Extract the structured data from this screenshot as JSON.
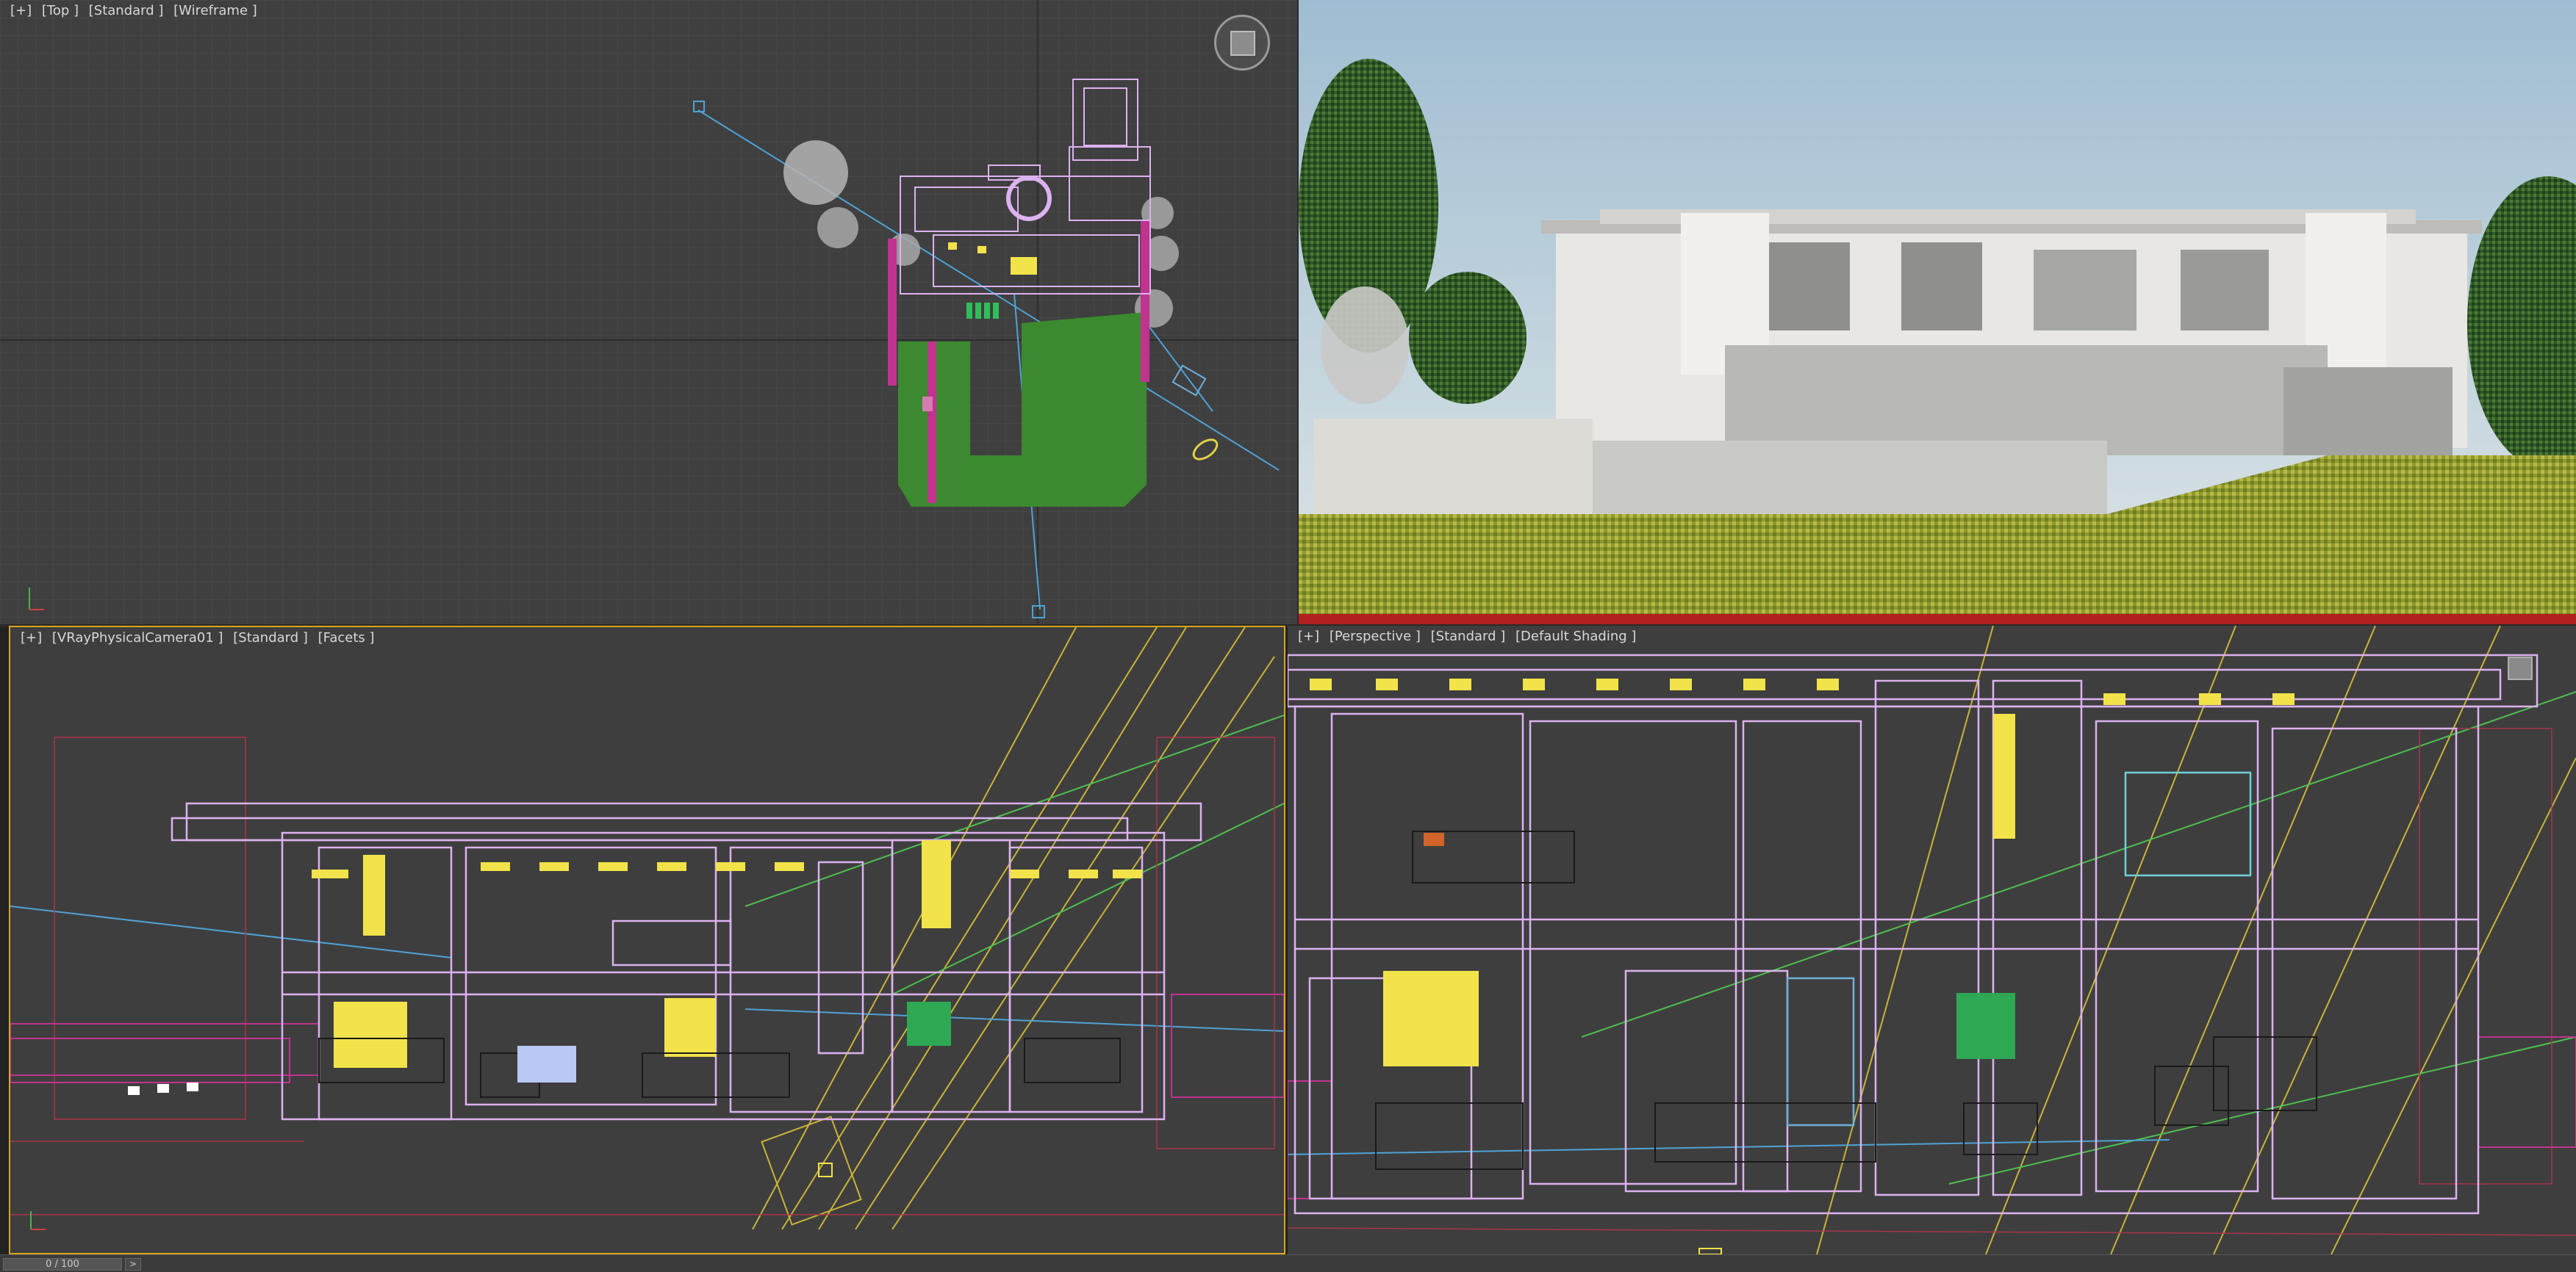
{
  "viewports": {
    "top": {
      "labels": [
        "[+]",
        "[Top ]",
        "[Standard ]",
        "[Wireframe ]"
      ]
    },
    "camera": {
      "labels": [
        "[+]",
        "[VRayPhysicalCamera01 ]",
        "[Standard ]",
        "[Facets ]"
      ]
    },
    "perspective": {
      "labels": [
        "[+]",
        "[Perspective ]",
        "[Standard ]",
        "[Default Shading ]"
      ]
    }
  },
  "statusbar": {
    "frame": "0 / 100",
    "next_icon": ">"
  },
  "colors": {
    "viewport_bg": "#3f3f3f",
    "grid": "#4d4d4d",
    "active_border": "#d9a51c",
    "wire_pink": "#dcb2f0",
    "wire_yellow": "#f2e34a",
    "wire_magenta": "#c0338f",
    "sky": "#b8cfde",
    "lawn": "#9ea338",
    "building_white": "#e8e7e3"
  }
}
